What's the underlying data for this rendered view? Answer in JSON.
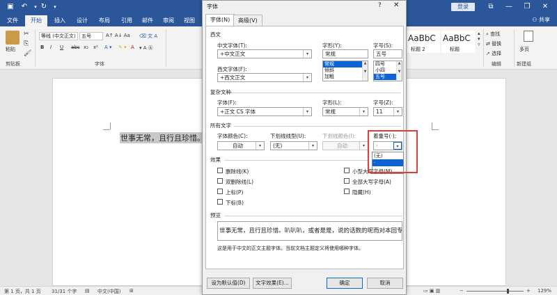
{
  "titlebar": {
    "login_label": "登录",
    "accent": "#2b579a",
    "quick_access": [
      "save-icon",
      "undo-icon",
      "redo-icon",
      "customize-icon"
    ],
    "window_controls": [
      "ribbon-options-icon",
      "minimize-icon",
      "restore-icon",
      "close-icon"
    ]
  },
  "tabs": [
    "文件",
    "开始",
    "插入",
    "设计",
    "布局",
    "引用",
    "邮件",
    "审阅",
    "视图"
  ],
  "active_tab": "开始",
  "share_label": "共享",
  "ribbon": {
    "clipboard": {
      "paste": "粘贴",
      "group": "剪贴板"
    },
    "font": {
      "font_name": "等线 (中文正文)",
      "font_size": "五号",
      "group": "字体",
      "format_buttons": [
        "B",
        "I",
        "U",
        "abc",
        "x₂",
        "x²",
        "A"
      ]
    },
    "styles": {
      "tiles": [
        {
          "sample": "AaBbC",
          "name": "标题 2"
        },
        {
          "sample": "AaBbC",
          "name": "标题"
        }
      ]
    },
    "editing": {
      "find": "查找",
      "replace": "替换",
      "select": "选择",
      "group": "编辑"
    },
    "new_group": {
      "label": "多页",
      "group": "新建组"
    }
  },
  "document": {
    "text": "世事无常，且行且珍惜。"
  },
  "statusbar": {
    "page": "第 1 页，共 1 页",
    "words": "31/31 个字",
    "language": "中文(中国)",
    "zoom": "129%"
  },
  "dialog": {
    "title": "字体",
    "help": "?",
    "close": "✕",
    "tabs": [
      "字体(N)",
      "高级(V)"
    ],
    "western_section": "西文",
    "chinese_font_label": "中文字体(T):",
    "chinese_font_value": "+中文正文",
    "western_font_label": "西文字体(F):",
    "western_font_value": "+西文正文",
    "style_label": "字形(Y):",
    "style_value": "常规",
    "style_list": [
      "常规",
      "倾斜",
      "加粗"
    ],
    "size_label": "字号(S):",
    "size_value": "五号",
    "size_list": [
      "四号",
      "小四",
      "五号"
    ],
    "complex_section": "复杂文种",
    "complex_font_label": "字体(F):",
    "complex_font_value": "+正文 CS 字体",
    "complex_style_label": "字形(L):",
    "complex_style_value": "常规",
    "complex_size_label": "字号(Z):",
    "complex_size_value": "11",
    "all_text_section": "所有文字",
    "font_color_label": "字体颜色(C):",
    "font_color_value": "自动",
    "underline_type_label": "下划线线型(U):",
    "underline_type_value": "(无)",
    "underline_color_label": "下划线颜色(I):",
    "underline_color_value": "自动",
    "emphasis_label": "着重号(·);",
    "emphasis_value": "·",
    "emphasis_options": [
      "(无)",
      "·"
    ],
    "effects_section": "效果",
    "effects_left": [
      "删除线(K)",
      "双删除线(L)",
      "上标(P)",
      "下标(B)"
    ],
    "effects_right": [
      "小型大写字母(M)",
      "全部大写字母(A)",
      "隐藏(H)"
    ],
    "preview_section": "预览",
    "preview_text": "世事无常，且行且珍惜。叭叭叭，或者是是，说的话数的呢而对本回专",
    "note": "这是用于中文的正文主题字体。当前文档主题定义将使用哪种字体。",
    "btn_default": "设为默认值(D)",
    "btn_effects": "文字效果(E)...",
    "btn_ok": "确定",
    "btn_cancel": "取消",
    "selection_color": "#0a64d8",
    "highlight_color": "#e03b3b"
  }
}
